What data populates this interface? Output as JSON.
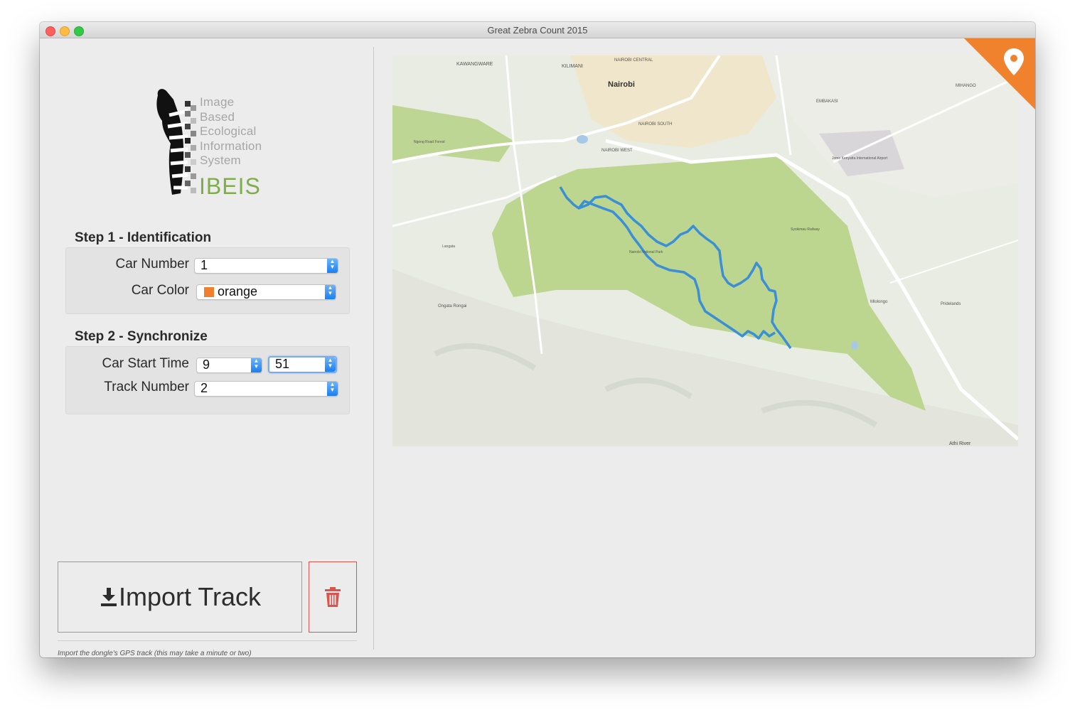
{
  "window": {
    "title": "Great Zebra Count 2015"
  },
  "logo": {
    "lines": [
      "Image",
      "Based",
      "Ecological",
      "Information",
      "System"
    ],
    "brand": "IBEIS"
  },
  "step1": {
    "title": "Step 1 - Identification",
    "car_number": {
      "label": "Car Number",
      "value": "1"
    },
    "car_color": {
      "label": "Car Color",
      "value": "orange",
      "swatch": "#f07f2e"
    }
  },
  "step2": {
    "title": "Step 2 - Synchronize",
    "start_time": {
      "label": "Car Start Time",
      "hour": "9",
      "minute": "51"
    },
    "track_number": {
      "label": "Track Number",
      "value": "2"
    }
  },
  "actions": {
    "import_label": "Import Track",
    "hint": "Import the dongle's GPS track (this may take a minute or two)"
  },
  "map": {
    "labels": [
      {
        "text": "Nairobi",
        "kind": "city"
      },
      {
        "text": "KILIMANI",
        "kind": "area"
      },
      {
        "text": "KAWANGWARE",
        "kind": "area"
      },
      {
        "text": "NAIROBI CENTRAL",
        "kind": "area"
      },
      {
        "text": "NAIROBI WEST",
        "kind": "area"
      },
      {
        "text": "NAIROBI SOUTH",
        "kind": "area"
      },
      {
        "text": "EMBAKASI",
        "kind": "area"
      },
      {
        "text": "MIHANGO",
        "kind": "area"
      },
      {
        "text": "Ngong Road Forest",
        "kind": "poi"
      },
      {
        "text": "Jomo Kenyatta International Airport",
        "kind": "poi"
      },
      {
        "text": "Nairobi National Park",
        "kind": "poi"
      },
      {
        "text": "Ongata Rongai",
        "kind": "place"
      },
      {
        "text": "Mlolongo",
        "kind": "place"
      },
      {
        "text": "Pridelands",
        "kind": "place"
      },
      {
        "text": "Athi River",
        "kind": "place"
      },
      {
        "text": "Syokimau Railway",
        "kind": "poi"
      },
      {
        "text": "Langata",
        "kind": "place"
      }
    ],
    "colors": {
      "park": "#b9d48a",
      "track": "#3b8fd6",
      "land": "#e9ece3"
    },
    "badge_icon": "map-pin-icon",
    "badge_color": "#f0822e"
  }
}
